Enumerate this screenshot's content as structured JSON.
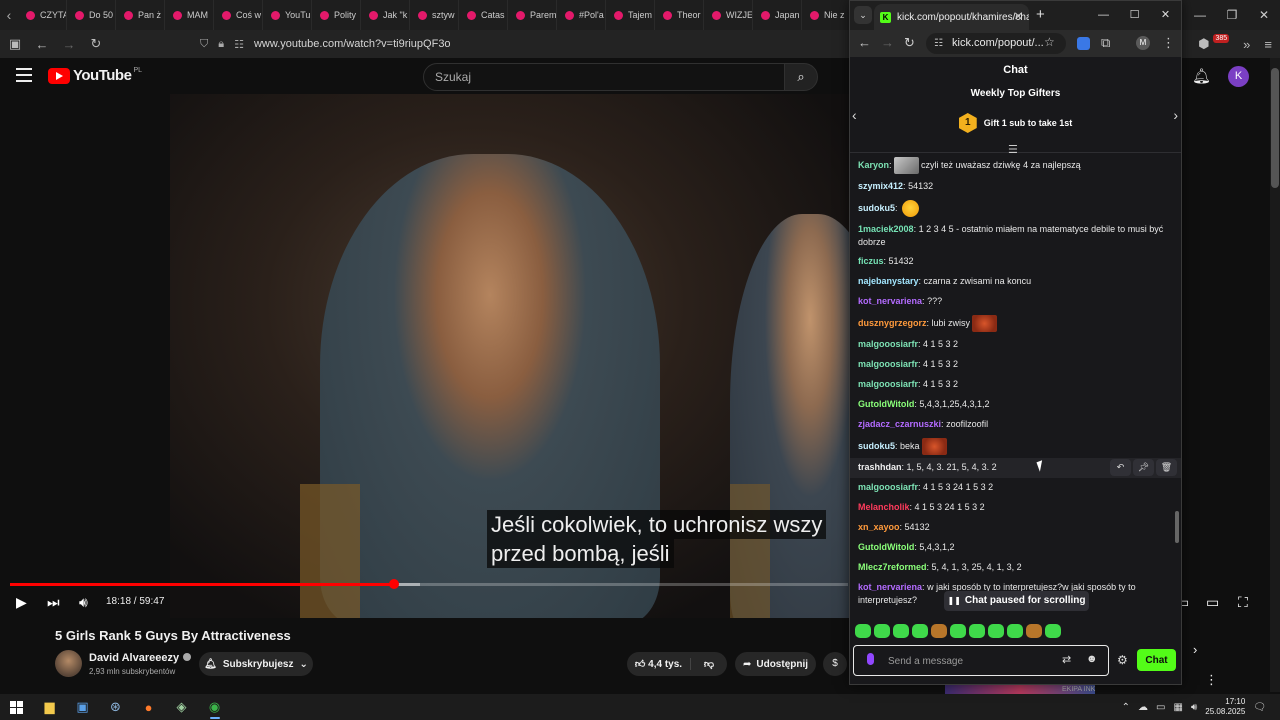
{
  "bg_browser": {
    "tabs": [
      "CZYTA",
      "Do 50",
      "Pan ż",
      "MAM",
      "Coś w",
      "YouTu",
      "Polity",
      "Jak \"k",
      "sztyw",
      "Catas",
      "Parem",
      "#Pol'a",
      "Tajem",
      "Theor",
      "WIZJE",
      "Japan",
      "Nie z"
    ],
    "url": "www.youtube.com/watch?v=ti9riupQF3o",
    "ext_badge": "385"
  },
  "youtube": {
    "logo_text": "YouTube",
    "logo_region": "PL",
    "search_placeholder": "Szukaj",
    "avatar_letter": "K",
    "subtitle_line1": "Jeśli cokolwiek, to uchronisz wszy",
    "subtitle_line2": "przed bombą, jeśli",
    "progress_fraction": 0.458,
    "time": "18:18 / 59:47",
    "video_title": "5 Girls Rank 5 Guys By Attractiveness",
    "channel_name": "David Alvareeezy",
    "channel_subs": "2,93 mln subskrybentów",
    "subscribe_label": "Subskrybujesz",
    "likes": "4,4 tys.",
    "share_label": "Udostępnij",
    "rec_text": "EKIPA INK"
  },
  "popout": {
    "tab_title": "kick.com/popout/khamires/chat",
    "url": "kick.com/popout/...",
    "profile_letter": "M",
    "chat_title": "Chat",
    "gifters_title": "Weekly Top Gifters",
    "rank": "1",
    "gift_text": "Gift 1 sub to take 1st",
    "messages": [
      {
        "user": "Karyon",
        "color": "#7de2b4",
        "text": " czyli też uważasz dziwkę 4 za najlepszą",
        "emote": "photo",
        "emote_pos": "before"
      },
      {
        "user": "szymix412",
        "color": "#c7f0ff",
        "text": " 54132"
      },
      {
        "user": "sudoku5",
        "color": "#c7f0ff",
        "text": " ",
        "emote": "face"
      },
      {
        "user": "1maciek2008",
        "color": "#76e3b5",
        "text": " 1 2 3 4 5 - ostatnio miałem na matematyce debile to musi być dobrze"
      },
      {
        "user": "ficzus",
        "color": "#76e3b5",
        "text": " 51432"
      },
      {
        "user": "najebanystary",
        "color": "#a3e6ff",
        "text": " czarna z zwisami na koncu"
      },
      {
        "user": "kot_nervariena",
        "color": "#b36bff",
        "text": " ???"
      },
      {
        "user": "dusznygrzegorz",
        "color": "#ff9a3c",
        "text": " lubi zwisy",
        "emote": "fire"
      },
      {
        "user": "malgooosiarfr",
        "color": "#7de2b4",
        "text": " 4 1 5 3 2"
      },
      {
        "user": "malgooosiarfr",
        "color": "#7de2b4",
        "text": " 4 1 5 3 2"
      },
      {
        "user": "malgooosiarfr",
        "color": "#7de2b4",
        "text": " 4 1 5 3 2"
      },
      {
        "user": "GutoldWitold",
        "color": "#8aff7a",
        "text": " 5,4,3,1,25,4,3,1,2"
      },
      {
        "user": "zjadacz_czarnuszki",
        "color": "#b36bff",
        "text": " zoofilzoofil"
      },
      {
        "user": "sudoku5",
        "color": "#c7f0ff",
        "text": " beka",
        "emote": "fire"
      },
      {
        "user": "trashhdan",
        "color": "#f0f0f0",
        "text": " 1, 5, 4, 3. 21, 5, 4, 3. 2",
        "hover": true
      },
      {
        "user": "malgooosiarfr",
        "color": "#7de2b4",
        "text": " 4 1 5 3 24 1 5 3 2"
      },
      {
        "user": "Melancholik",
        "color": "#ff3b5c",
        "text": " 4 1 5 3 24 1 5 3 2"
      },
      {
        "user": "xn_xayoo",
        "color": "#ff9a3c",
        "text": " 54132"
      },
      {
        "user": "GutoldWitold",
        "color": "#8aff7a",
        "text": " 5,4,3,1,2"
      },
      {
        "user": "Mlecz7reformed",
        "color": "#8aff7a",
        "text": " 5, 4, 1, 3, 25, 4, 1, 3, 2"
      },
      {
        "user": "kot_nervariena",
        "color": "#b36bff",
        "text": " w jaki sposób ty to interpretujesz?w jaki sposób ty to interpretujesz?"
      }
    ],
    "paused_label": "Chat paused for scrolling",
    "input_placeholder": "Send a message",
    "send_label": "Chat"
  },
  "taskbar": {
    "time": "17:10",
    "date": "25.08.2025"
  }
}
